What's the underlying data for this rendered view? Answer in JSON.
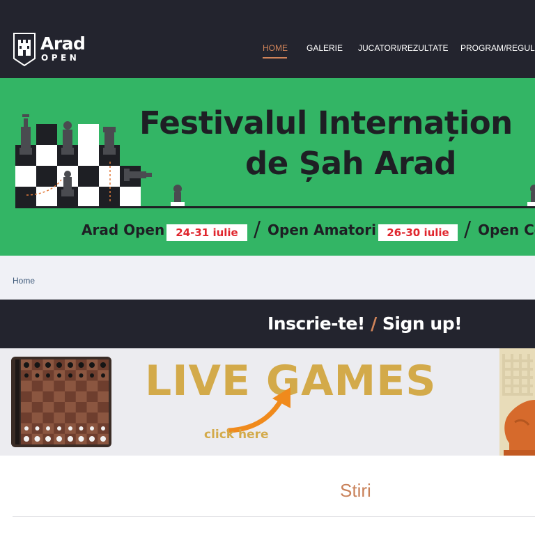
{
  "header": {
    "logo": {
      "name": "Arad",
      "sub": "OPEN"
    },
    "nav": [
      {
        "label": "HOME",
        "active": true
      },
      {
        "label": "GALERIE",
        "active": false
      },
      {
        "label": "JUCATORI/REZULTATE",
        "active": false
      },
      {
        "label": "PROGRAM/REGULI",
        "active": false
      }
    ],
    "colors": {
      "background": "#23242e",
      "accent": "#d0845a"
    }
  },
  "banner": {
    "title_line1": "Festivalul Internațion",
    "title_line2": "de Șah Arad",
    "events": [
      {
        "name": "Arad Open",
        "dates": "24-31 iulie"
      },
      {
        "name": "Open Amatori",
        "dates": "26-30 iulie"
      },
      {
        "name": "Open Co"
      }
    ],
    "colors": {
      "background": "#33b565",
      "date_text": "#e0262e"
    }
  },
  "breadcrumb": {
    "home": "Home"
  },
  "signup": {
    "part1": "Inscrie-te!",
    "separator": "/",
    "part2": "Sign up!"
  },
  "live_games": {
    "title": "LIVE GAMES",
    "cta": "click here",
    "colors": {
      "title": "#d3aa4a",
      "arrow": "#f08a1c"
    },
    "icons": [
      "chessboard-icon",
      "arrow-icon",
      "knight-icon"
    ]
  },
  "news": {
    "title": "Stiri"
  }
}
